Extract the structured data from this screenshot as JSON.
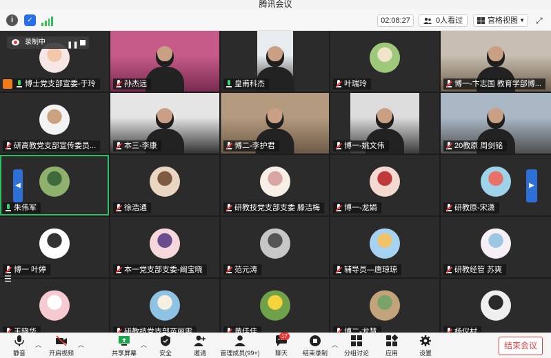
{
  "window": {
    "title": "腾讯会议"
  },
  "topbar": {
    "timer": "02:08:27",
    "viewers": "0人看过",
    "view_mode": "宫格视图"
  },
  "recording": {
    "label": "录制中"
  },
  "participants": [
    {
      "name": "博士党支部宣委-于玲",
      "mic": "live",
      "badge": "orange",
      "kind": "avatar",
      "colors": [
        "#f7e6e6",
        "#f2c9a8"
      ]
    },
    {
      "name": "孙杰远",
      "mic": "muted",
      "kind": "video",
      "colors": [
        "#c65b8a",
        "#7a2a50"
      ]
    },
    {
      "name": "皇甫科杰",
      "mic": "live",
      "kind": "video",
      "colors": [
        "#e9ecef",
        "#2b2b2b"
      ]
    },
    {
      "name": "叶瑞玲",
      "mic": "muted",
      "kind": "avatar",
      "colors": [
        "#9ec97b",
        "#f1e5c9"
      ]
    },
    {
      "name": "博一-卞志国  教育学部博...",
      "mic": "muted",
      "kind": "video",
      "colors": [
        "#c8bfb2",
        "#6f5f4c"
      ]
    },
    {
      "name": "研高教党支部宣传委员...",
      "mic": "muted",
      "kind": "avatar",
      "colors": [
        "#f3f3f3",
        "#caa27f"
      ]
    },
    {
      "name": "本三-李康",
      "mic": "muted",
      "kind": "video",
      "colors": [
        "#e5e5e5",
        "#333333"
      ]
    },
    {
      "name": "博二-李护君",
      "mic": "muted",
      "kind": "video",
      "colors": [
        "#b49a7f",
        "#6c5a46"
      ]
    },
    {
      "name": "博一-姚文伟",
      "mic": "muted",
      "kind": "video",
      "colors": [
        "#dcdcdc",
        "#3b3b3b"
      ]
    },
    {
      "name": "20教原 周剑铭",
      "mic": "muted",
      "kind": "video",
      "colors": [
        "#a9b7c5",
        "#4f4f4f"
      ]
    },
    {
      "name": "朱伟军",
      "mic": "live",
      "kind": "avatar",
      "active": true,
      "colors": [
        "#8fb16d",
        "#3f6b3a"
      ]
    },
    {
      "name": "徐浩通",
      "mic": "muted",
      "kind": "avatar",
      "colors": [
        "#e8d6c3",
        "#7d5a41"
      ]
    },
    {
      "name": "研教技党支部支委 滕洁梅",
      "mic": "muted",
      "kind": "avatar",
      "colors": [
        "#f7efe6",
        "#d9a4a4"
      ]
    },
    {
      "name": "博一-龙娟",
      "mic": "muted",
      "kind": "avatar",
      "colors": [
        "#f3d9d0",
        "#c0393b"
      ]
    },
    {
      "name": "研教原-宋潇",
      "mic": "muted",
      "kind": "avatar",
      "colors": [
        "#9fd3ea",
        "#e8716a"
      ]
    },
    {
      "name": "博一 叶婷",
      "mic": "muted",
      "kind": "avatar",
      "colors": [
        "#ffffff",
        "#333333"
      ]
    },
    {
      "name": "本一党支部支委-阚宝晓",
      "mic": "muted",
      "kind": "avatar",
      "colors": [
        "#f6d7dc",
        "#6b4d8f"
      ]
    },
    {
      "name": "范元涛",
      "mic": "muted",
      "kind": "avatar",
      "colors": [
        "#c7c7c7",
        "#555555"
      ]
    },
    {
      "name": "辅导员—唐琼琼",
      "mic": "muted",
      "kind": "avatar",
      "colors": [
        "#a5d2f0",
        "#f0c36b"
      ]
    },
    {
      "name": "研教经管 苏爽",
      "mic": "muted",
      "kind": "avatar",
      "colors": [
        "#f6f0f6",
        "#9cc7e0"
      ]
    },
    {
      "name": "王晓华",
      "mic": "muted",
      "kind": "avatar",
      "colors": [
        "#f7c9d0",
        "#ffffff"
      ]
    },
    {
      "name": "研教技党支部苗丽雯",
      "mic": "muted",
      "kind": "avatar",
      "colors": [
        "#8ec3e3",
        "#f7f0e0"
      ]
    },
    {
      "name": "黄佳佳",
      "mic": "muted",
      "kind": "avatar",
      "colors": [
        "#6fa04a",
        "#f5d33a"
      ]
    },
    {
      "name": "博二-龙慧",
      "mic": "muted",
      "kind": "avatar",
      "colors": [
        "#c2a37c",
        "#7aa36a"
      ]
    },
    {
      "name": "杨仪村",
      "mic": "muted",
      "kind": "avatar",
      "colors": [
        "#efefef",
        "#2a2a2a"
      ]
    }
  ],
  "toolbar": {
    "mute": "静音",
    "video": "开启视频",
    "share": "共享屏幕",
    "security": "安全",
    "invite": "邀请",
    "members": "管理成员(99+)",
    "chat": "聊天",
    "chat_badge": "17",
    "end_record": "结束录制",
    "breakout": "分组讨论",
    "apps": "应用",
    "settings": "设置",
    "end_meeting": "结束会议"
  }
}
